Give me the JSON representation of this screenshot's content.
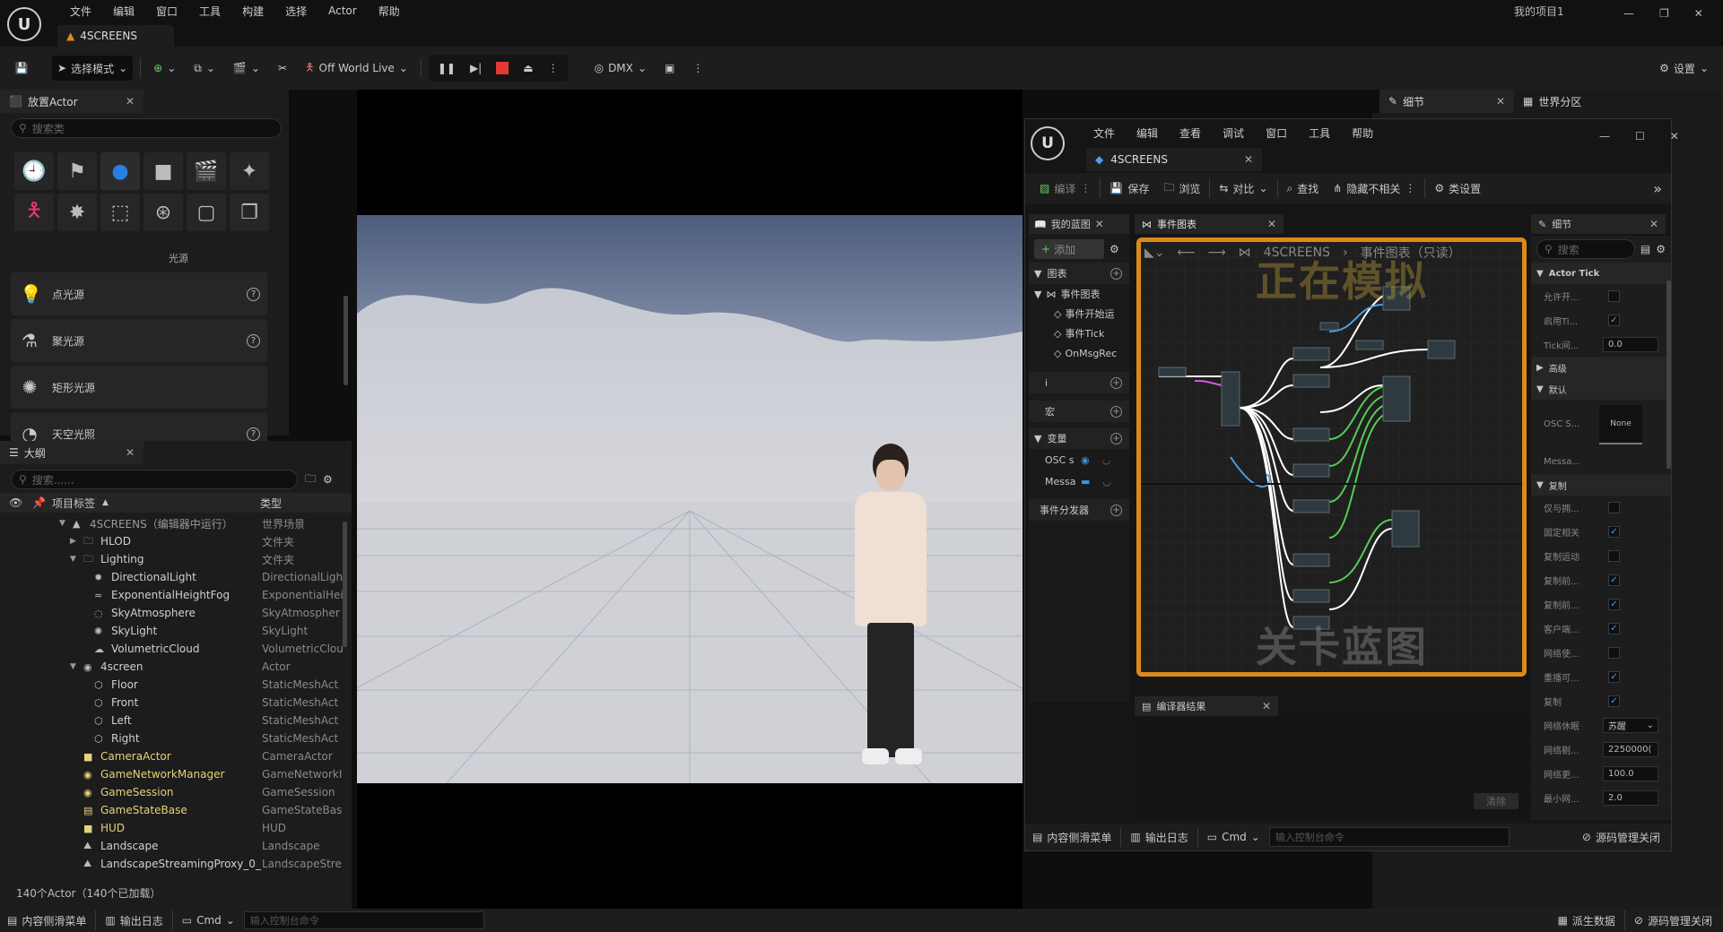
{
  "app": {
    "project_name": "我的项目1",
    "level_tab": "4SCREENS",
    "menu": [
      "文件",
      "编辑",
      "窗口",
      "工具",
      "构建",
      "选择",
      "Actor",
      "帮助"
    ]
  },
  "toolbar": {
    "mode": "选择模式",
    "world": "Off World Live",
    "dmx": "DMX",
    "settings": "设置"
  },
  "place_actor": {
    "title": "放置Actor",
    "search_placeholder": "搜索类",
    "category_label": "光源",
    "category_icons": [
      "recent-icon",
      "basic-icon",
      "light-icon",
      "shapes-icon",
      "cinematic-icon",
      "visual-effects-icon",
      "character-icon",
      "all-classes-icon",
      "geometry-icon",
      "media-icon",
      "volumes-icon",
      "copy-icon"
    ],
    "items": [
      {
        "label": "点光源",
        "icon": "point-light-icon"
      },
      {
        "label": "聚光源",
        "icon": "spot-light-icon"
      },
      {
        "label": "矩形光源",
        "icon": "rect-light-icon"
      },
      {
        "label": "天空光照",
        "icon": "sky-light-icon"
      }
    ]
  },
  "outliner": {
    "title": "大纲",
    "search_placeholder": "搜索......",
    "col_label": "项目标签",
    "col_type": "类型",
    "rows": [
      {
        "name": "4SCREENS（编辑器中运行）",
        "type": "世界场景",
        "depth": 0,
        "arrow": "▼",
        "icon": "level-icon",
        "color": "#9a9a9a"
      },
      {
        "name": "HLOD",
        "type": "文件夹",
        "depth": 1,
        "arrow": "▶",
        "icon": "folder-icon",
        "color": "#d0d0d0"
      },
      {
        "name": "Lighting",
        "type": "文件夹",
        "depth": 1,
        "arrow": "▼",
        "icon": "folder-icon",
        "color": "#d0d0d0"
      },
      {
        "name": "DirectionalLight",
        "type": "DirectionalLigh",
        "depth": 2,
        "arrow": "",
        "icon": "directional-light-icon",
        "color": "#d0d0d0"
      },
      {
        "name": "ExponentialHeightFog",
        "type": "ExponentialHei",
        "depth": 2,
        "arrow": "",
        "icon": "fog-icon",
        "color": "#d0d0d0"
      },
      {
        "name": "SkyAtmosphere",
        "type": "SkyAtmospher",
        "depth": 2,
        "arrow": "",
        "icon": "atmosphere-icon",
        "color": "#d0d0d0"
      },
      {
        "name": "SkyLight",
        "type": "SkyLight",
        "depth": 2,
        "arrow": "",
        "icon": "skylight-icon",
        "color": "#d0d0d0"
      },
      {
        "name": "VolumetricCloud",
        "type": "VolumetricClou",
        "depth": 2,
        "arrow": "",
        "icon": "cloud-icon",
        "color": "#d0d0d0"
      },
      {
        "name": "4screen",
        "type": "Actor",
        "depth": 1,
        "arrow": "▼",
        "icon": "actor-icon",
        "color": "#d0d0d0"
      },
      {
        "name": "Floor",
        "type": "StaticMeshAct",
        "depth": 2,
        "arrow": "",
        "icon": "mesh-icon",
        "color": "#d0d0d0"
      },
      {
        "name": "Front",
        "type": "StaticMeshAct",
        "depth": 2,
        "arrow": "",
        "icon": "mesh-icon",
        "color": "#d0d0d0"
      },
      {
        "name": "Left",
        "type": "StaticMeshAct",
        "depth": 2,
        "arrow": "",
        "icon": "mesh-icon",
        "color": "#d0d0d0"
      },
      {
        "name": "Right",
        "type": "StaticMeshAct",
        "depth": 2,
        "arrow": "",
        "icon": "mesh-icon",
        "color": "#d0d0d0"
      },
      {
        "name": "CameraActor",
        "type": "CameraActor",
        "depth": 1,
        "arrow": "",
        "icon": "camera-icon",
        "color": "#e6d27a"
      },
      {
        "name": "GameNetworkManager",
        "type": "GameNetworkI",
        "depth": 1,
        "arrow": "",
        "icon": "actor-icon",
        "color": "#e6d27a"
      },
      {
        "name": "GameSession",
        "type": "GameSession",
        "depth": 1,
        "arrow": "",
        "icon": "actor-icon",
        "color": "#e6d27a"
      },
      {
        "name": "GameStateBase",
        "type": "GameStateBas",
        "depth": 1,
        "arrow": "",
        "icon": "gamestate-icon",
        "color": "#e6d27a"
      },
      {
        "name": "HUD",
        "type": "HUD",
        "depth": 1,
        "arrow": "",
        "icon": "hud-icon",
        "color": "#e6d27a"
      },
      {
        "name": "Landscape",
        "type": "Landscape",
        "depth": 1,
        "arrow": "",
        "icon": "landscape-icon",
        "color": "#d0d0d0"
      },
      {
        "name": "LandscapeStreamingProxy_0_",
        "type": "LandscapeStre",
        "depth": 1,
        "arrow": "",
        "icon": "landscape-icon",
        "color": "#d0d0d0"
      }
    ],
    "status": "140个Actor（140个已加载）"
  },
  "right_tabs": {
    "details": "细节",
    "world_partition": "世界分区"
  },
  "blueprint": {
    "menu": [
      "文件",
      "编辑",
      "查看",
      "调试",
      "窗口",
      "工具",
      "帮助"
    ],
    "tab": "4SCREENS",
    "toolbar": {
      "compile": "编译",
      "save": "保存",
      "browse": "浏览",
      "diff": "对比",
      "find": "查找",
      "hide_unrelated": "隐藏不相关",
      "class_settings": "类设置"
    },
    "my_blueprint": {
      "tab": "我的蓝图",
      "add": "添加",
      "graphs": "图表",
      "event_graph": "事件图表",
      "events": [
        "事件开始运",
        "事件Tick",
        "OnMsgRec"
      ],
      "functions": "i",
      "macros": "宏",
      "variables": "变量",
      "vars": [
        "OSC s",
        "Messa"
      ],
      "dispatchers": "事件分发器"
    },
    "graph": {
      "tab": "事件图表",
      "breadcrumb_root": "4SCREENS",
      "breadcrumb_leaf": "事件图表（只读）",
      "simulating": "正在模拟",
      "watermark": "关卡蓝图"
    },
    "compiler": {
      "tab": "编译器结果",
      "clear": "清除"
    },
    "details": {
      "tab": "细节",
      "search_placeholder": "搜索",
      "section_tick": "Actor Tick",
      "tick_rows": [
        {
          "label": "允许开...",
          "kind": "check",
          "checked": false
        },
        {
          "label": "启用Ti...",
          "kind": "check",
          "checked": true
        },
        {
          "label": "Tick间...",
          "kind": "input",
          "value": "0.0"
        }
      ],
      "section_advanced": "高级",
      "section_default": "默认",
      "osc_label": "OSC S...",
      "none_label": "None",
      "messa_label": "Messa...",
      "section_replication": "复制",
      "rep_rows": [
        {
          "label": "仅与拥...",
          "kind": "check",
          "checked": false
        },
        {
          "label": "固定相关",
          "kind": "check",
          "checked": true
        },
        {
          "label": "复制运动",
          "kind": "check",
          "checked": false
        },
        {
          "label": "复制前...",
          "kind": "check",
          "checked": true
        },
        {
          "label": "复制前...",
          "kind": "check",
          "checked": true
        },
        {
          "label": "客户端...",
          "kind": "check",
          "checked": true
        },
        {
          "label": "网络使...",
          "kind": "check",
          "checked": false
        },
        {
          "label": "重播可...",
          "kind": "check",
          "checked": true
        },
        {
          "label": "复制",
          "kind": "check",
          "checked": true
        },
        {
          "label": "网络休眠",
          "kind": "select",
          "value": "苏醒"
        },
        {
          "label": "网络剔...",
          "kind": "input",
          "value": "2250000("
        },
        {
          "label": "网络更...",
          "kind": "input",
          "value": "100.0"
        },
        {
          "label": "最小网...",
          "kind": "input",
          "value": "2.0"
        }
      ]
    },
    "bottom": {
      "drawer": "内容侧滑菜单",
      "output": "输出日志",
      "cmd": "Cmd",
      "console_placeholder": "输入控制台命令",
      "source": "源码管理关闭"
    }
  },
  "main_bottom": {
    "drawer": "内容侧滑菜单",
    "output": "输出日志",
    "cmd": "Cmd",
    "console_placeholder": "输入控制台命令",
    "derived": "派生数据",
    "source": "源码管理关闭"
  },
  "colors": {
    "accent": "#3d8fe6",
    "orange_border": "#d98a1c",
    "bg": "#151515",
    "panel": "#1e1e1e"
  }
}
